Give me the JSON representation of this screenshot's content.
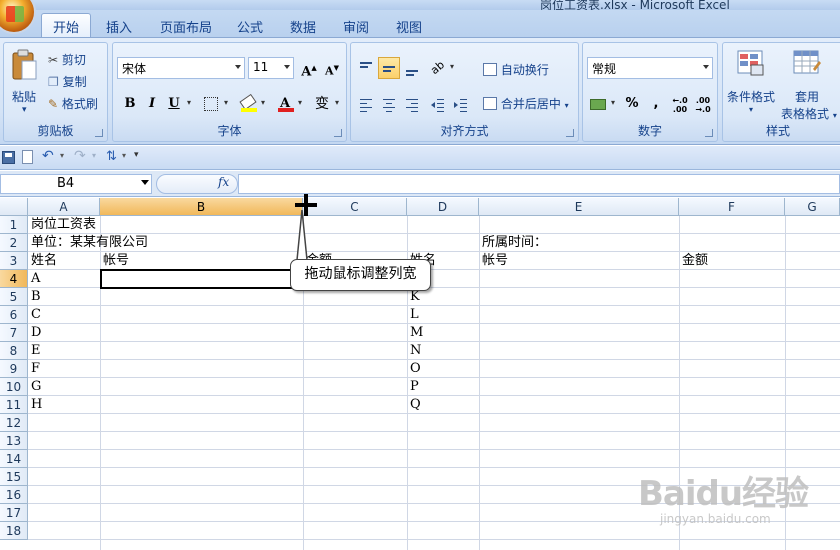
{
  "window": {
    "title": "岗位工资表.xlsx - Microsoft Excel"
  },
  "tabs": [
    "开始",
    "插入",
    "页面布局",
    "公式",
    "数据",
    "审阅",
    "视图"
  ],
  "clipboard": {
    "paste": "粘贴",
    "cut": "剪切",
    "copy": "复制",
    "format_painter": "格式刷",
    "label": "剪贴板"
  },
  "font": {
    "name": "宋体",
    "size": "11",
    "grow": "A",
    "shrink": "A",
    "bold": "B",
    "italic": "I",
    "underline": "U",
    "phonetic": "变",
    "label": "字体"
  },
  "alignment": {
    "wrap": "自动换行",
    "merge": "合并后居中",
    "label": "对齐方式"
  },
  "number": {
    "format": "常规",
    "percent": "%",
    "comma": ",",
    "label": "数字"
  },
  "styles": {
    "conditional": "条件格式",
    "table_line1": "套用",
    "table_line2": "表格格式",
    "label": "样式"
  },
  "name_box": "B4",
  "fx": "fx",
  "columns": [
    "A",
    "B",
    "C",
    "D",
    "E",
    "F",
    "G"
  ],
  "rows": [
    "1",
    "2",
    "3",
    "4",
    "5",
    "6",
    "7",
    "8",
    "9",
    "10",
    "11",
    "12",
    "13",
    "14",
    "15",
    "16",
    "17",
    "18"
  ],
  "cells": {
    "a1": "岗位工资表",
    "a2": "单位：某某有限公司",
    "e2": "所属时间：",
    "a3": "姓名",
    "b3": "帐号",
    "c3": "金额",
    "d3": "姓名",
    "e3": "帐号",
    "f3": "金额",
    "a4": "A",
    "a5": "B",
    "a6": "C",
    "a7": "D",
    "a8": "E",
    "a9": "F",
    "a10": "G",
    "a11": "H",
    "d5": "K",
    "d6": "L",
    "d7": "M",
    "d8": "N",
    "d9": "O",
    "d10": "P",
    "d11": "Q"
  },
  "callout": "拖动鼠标调整列宽",
  "watermark": {
    "brand": "Baidu经验",
    "url": "jingyan.baidu.com"
  },
  "colors": {
    "ribbon": "#dbe8f8",
    "selected_header": "#f1b85a",
    "text": "#15428b"
  }
}
